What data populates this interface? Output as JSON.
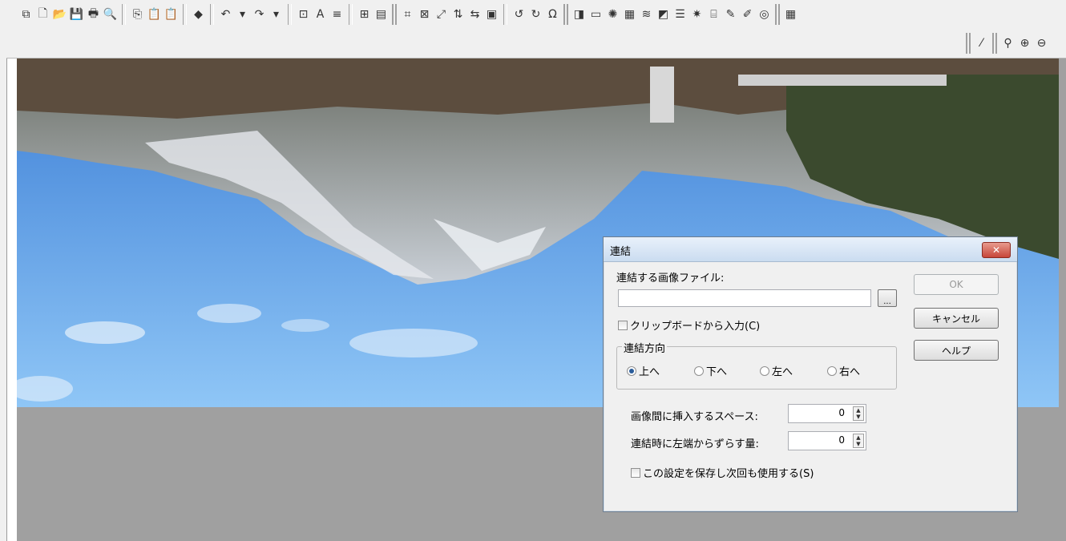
{
  "toolbar": {
    "row1": [
      "new-window-icon",
      "new-file-icon",
      "open-icon",
      "save-icon",
      "print-icon",
      "print-preview-icon",
      "|",
      "copy-icon",
      "paste-icon",
      "paste-new-icon",
      "|",
      "paint-fill-icon",
      "|",
      "undo-icon",
      "undo-dropdown-icon",
      "redo-icon",
      "redo-dropdown-icon",
      "|",
      "fit-icon",
      "text-icon",
      "align-icon",
      "|",
      "grid-icon",
      "filmstrip-icon",
      "||",
      "crop-icon",
      "trim-icon",
      "resize-icon",
      "flip-vertical-icon",
      "flip-horizontal-icon",
      "canvas-icon",
      "|",
      "rotate-left-icon",
      "rotate-right-icon",
      "rotate-free-icon",
      "||",
      "shadow-icon",
      "frame-icon",
      "sun-icon",
      "mosaic-icon",
      "wave-icon",
      "emboss-icon",
      "lines-icon",
      "sharpen-icon",
      "grid-filter-icon",
      "pen-icon",
      "eraser-icon",
      "spiral-icon",
      "||",
      "color-palette-icon"
    ],
    "row2": [
      "||",
      "eyedropper-icon",
      "||",
      "zoom-dropdown-icon",
      "zoom-in-icon",
      "zoom-out-icon"
    ],
    "glyphs": {
      "new-window-icon": "⧉",
      "new-file-icon": "🗋",
      "open-icon": "📂",
      "save-icon": "💾",
      "print-icon": "🖶",
      "print-preview-icon": "🔍",
      "copy-icon": "⎘",
      "paste-icon": "📋",
      "paste-new-icon": "📋",
      "paint-fill-icon": "◆",
      "undo-icon": "↶",
      "undo-dropdown-icon": "▾",
      "redo-icon": "↷",
      "redo-dropdown-icon": "▾",
      "fit-icon": "⊡",
      "text-icon": "A",
      "align-icon": "≡",
      "grid-icon": "⊞",
      "filmstrip-icon": "▤",
      "crop-icon": "⌗",
      "trim-icon": "⊠",
      "resize-icon": "⤢",
      "flip-vertical-icon": "⇅",
      "flip-horizontal-icon": "⇆",
      "canvas-icon": "▣",
      "rotate-left-icon": "↺",
      "rotate-right-icon": "↻",
      "rotate-free-icon": "Ω",
      "shadow-icon": "◨",
      "frame-icon": "▭",
      "sun-icon": "✺",
      "mosaic-icon": "▦",
      "wave-icon": "≋",
      "emboss-icon": "◩",
      "lines-icon": "☰",
      "sharpen-icon": "✷",
      "grid-filter-icon": "⌸",
      "pen-icon": "✎",
      "eraser-icon": "✐",
      "spiral-icon": "◎",
      "color-palette-icon": "▦",
      "eyedropper-icon": "⁄",
      "zoom-dropdown-icon": "⚲",
      "zoom-in-icon": "⊕",
      "zoom-out-icon": "⊖"
    }
  },
  "dialog": {
    "title": "連結",
    "close_label": "✕",
    "file_label": "連結する画像ファイル:",
    "file_value": "",
    "browse_label": "...",
    "ok_label": "OK",
    "cancel_label": "キャンセル",
    "help_label": "ヘルプ",
    "clipboard_label": "クリップボードから入力(C)",
    "direction_group": "連結方向",
    "directions": [
      {
        "label": "上へ",
        "selected": true
      },
      {
        "label": "下へ",
        "selected": false
      },
      {
        "label": "左へ",
        "selected": false
      },
      {
        "label": "右へ",
        "selected": false
      }
    ],
    "spacing_label": "画像間に挿入するスペース:",
    "spacing_value": "0",
    "offset_label": "連結時に左端からずらす量:",
    "offset_value": "0",
    "save_label": "この設定を保存し次回も使用する(S)"
  },
  "colors": {
    "sky": "#6fb2ef",
    "canvas_bg": "#a0a0a0",
    "title_grad": "#cadcf0"
  }
}
